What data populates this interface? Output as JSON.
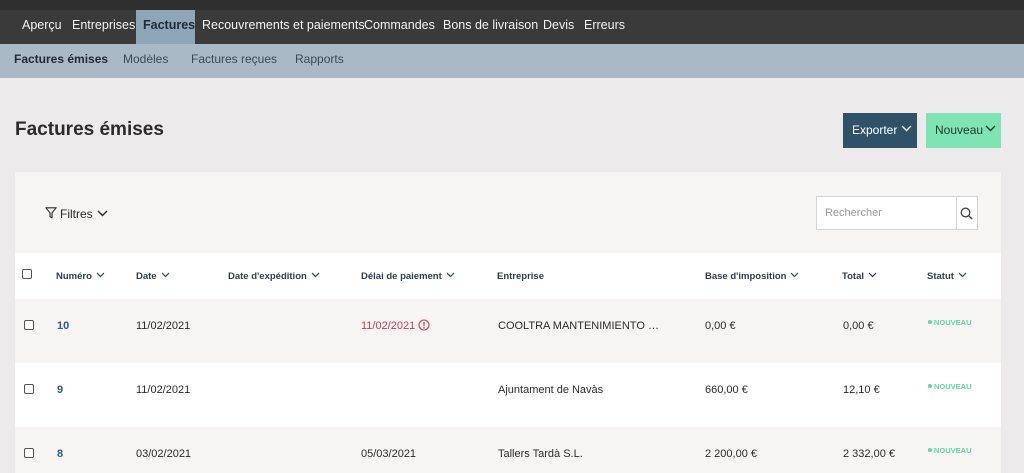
{
  "top_nav": {
    "items": [
      "Aperçu",
      "Entreprises",
      "Factures",
      "Recouvrements et paiements",
      "Commandes",
      "Bons de livraison",
      "Devis",
      "Erreurs"
    ],
    "active": "Factures"
  },
  "sub_nav": {
    "items": [
      "Factures émises",
      "Modèles",
      "Factures reçues",
      "Rapports"
    ],
    "active": "Factures émises"
  },
  "page": {
    "title": "Factures émises",
    "export_label": "Exporter",
    "new_label": "Nouveau"
  },
  "toolbar": {
    "filters_label": "Filtres",
    "search_placeholder": "Rechercher"
  },
  "table": {
    "headers": [
      "Numéro",
      "Date",
      "Date d'expédition",
      "Délai de paiement",
      "Entreprise",
      "Base d'imposition",
      "Total",
      "Statut"
    ],
    "rows": [
      {
        "number": "10",
        "date": "11/02/2021",
        "shipping_date": "",
        "due_date": "11/02/2021",
        "due_overdue": true,
        "company": "COOLTRA MANTENIMIENTO …",
        "tax_base": "0,00 €",
        "total": "0,00 €",
        "status": "NOUVEAU"
      },
      {
        "number": "9",
        "date": "11/02/2021",
        "shipping_date": "",
        "due_date": "",
        "due_overdue": false,
        "company": "Ajuntament de Navàs",
        "tax_base": "660,00 €",
        "total": "12,10 €",
        "status": "NOUVEAU"
      },
      {
        "number": "8",
        "date": "03/02/2021",
        "shipping_date": "",
        "due_date": "05/03/2021",
        "due_overdue": false,
        "company": "Tallers Tardà S.L.",
        "tax_base": "2 200,00 €",
        "total": "2 332,00 €",
        "status": "NOUVEAU"
      }
    ]
  },
  "colors": {
    "top_nav_bg": "#3a3a3a",
    "sub_nav_bg": "#a9b9c5",
    "export_button": "#2f5269",
    "new_button": "#7fe4b3",
    "status_new": "#5fd79a",
    "overdue": "#d23a4a"
  }
}
